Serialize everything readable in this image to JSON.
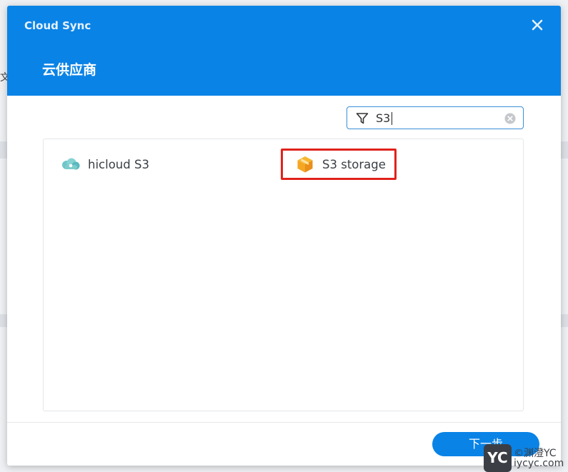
{
  "background": {
    "text": "文"
  },
  "dialog": {
    "app_title": "Cloud Sync",
    "step_title": "云供应商",
    "close_icon": "close-icon",
    "colors": {
      "header": "#0a83e6",
      "highlight": "#e0221b"
    }
  },
  "search": {
    "value": "S3",
    "filter_icon": "filter-icon",
    "clear_icon": "clear-icon"
  },
  "providers": [
    {
      "label": "hicloud S3",
      "icon": "hicloud-icon"
    },
    {
      "label": "S3 storage",
      "icon": "s3-box-icon",
      "highlighted": true
    }
  ],
  "footer": {
    "next_label": "下一步"
  },
  "watermark": {
    "logo": "YC",
    "line1": "©渊澄YC",
    "line2": "iycyc.com"
  }
}
